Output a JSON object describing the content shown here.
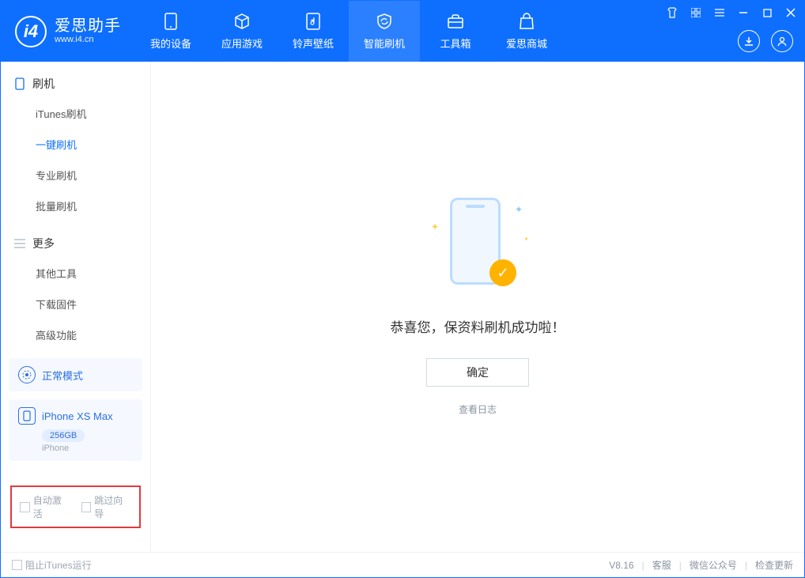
{
  "app": {
    "name_cn": "爱思助手",
    "url": "www.i4.cn"
  },
  "nav": {
    "items": [
      {
        "label": "我的设备"
      },
      {
        "label": "应用游戏"
      },
      {
        "label": "铃声壁纸"
      },
      {
        "label": "智能刷机"
      },
      {
        "label": "工具箱"
      },
      {
        "label": "爱思商城"
      }
    ],
    "active_index": 3
  },
  "sidebar": {
    "section1": {
      "title": "刷机",
      "items": [
        "iTunes刷机",
        "一键刷机",
        "专业刷机",
        "批量刷机"
      ],
      "active_index": 1
    },
    "section2": {
      "title": "更多",
      "items": [
        "其他工具",
        "下载固件",
        "高级功能"
      ]
    },
    "mode_label": "正常模式",
    "device": {
      "name": "iPhone XS Max",
      "storage": "256GB",
      "type": "iPhone"
    },
    "checks": {
      "auto_activate": "自动激活",
      "skip_guide": "跳过向导"
    }
  },
  "main": {
    "success_msg": "恭喜您，保资料刷机成功啦！",
    "ok_btn": "确定",
    "log_link": "查看日志"
  },
  "footer": {
    "block_itunes": "阻止iTunes运行",
    "version": "V8.16",
    "links": [
      "客服",
      "微信公众号",
      "检查更新"
    ]
  }
}
